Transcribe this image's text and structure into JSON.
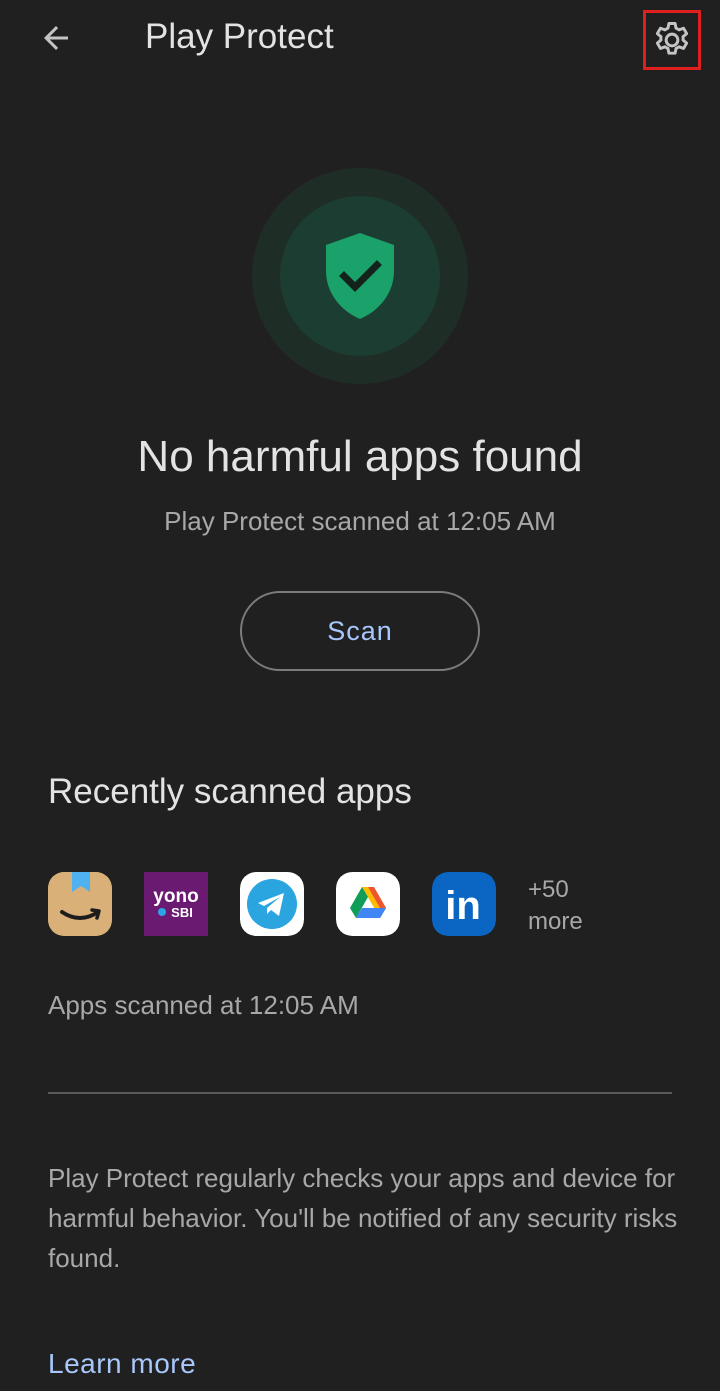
{
  "header": {
    "title": "Play Protect",
    "back_icon": "arrow-left-icon",
    "settings_icon": "gear-icon",
    "highlight_color": "#e0201e"
  },
  "status": {
    "icon": "shield-check-icon",
    "headline": "No harmful apps found",
    "subline": "Play Protect scanned at 12:05 AM",
    "accent_color": "#1aa26a"
  },
  "scan_button": {
    "label": "Scan"
  },
  "recent": {
    "title": "Recently scanned apps",
    "apps": [
      {
        "name": "Amazon",
        "icon": "amazon-icon"
      },
      {
        "name": "YONO SBI",
        "icon": "yono-sbi-icon",
        "text_top": "yono",
        "text_bottom": "SBI"
      },
      {
        "name": "Telegram",
        "icon": "telegram-icon"
      },
      {
        "name": "Google Drive",
        "icon": "google-drive-icon"
      },
      {
        "name": "LinkedIn",
        "icon": "linkedin-icon",
        "text": "in"
      }
    ],
    "more_count": "+50",
    "more_label": "more",
    "scanned_at": "Apps scanned at 12:05 AM"
  },
  "info": {
    "text": "Play Protect regularly checks your apps and device for harmful behavior. You'll be notified of any security risks found.",
    "learn_more": "Learn more"
  },
  "colors": {
    "background": "#202020",
    "link": "#a8c7fa"
  }
}
